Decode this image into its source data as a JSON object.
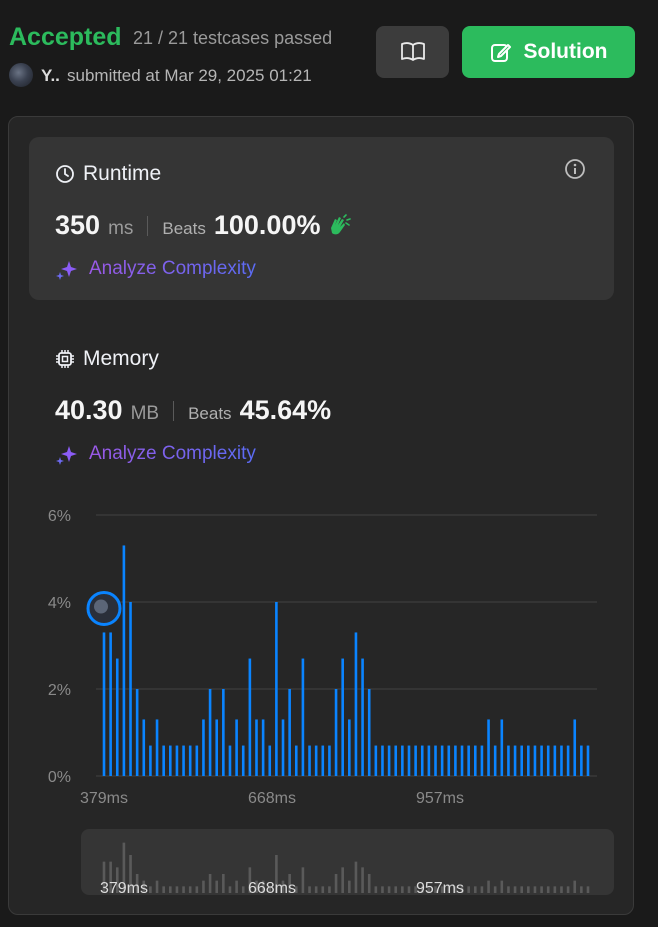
{
  "header": {
    "status": "Accepted",
    "testcases": "21 / 21 testcases passed",
    "user": "Y..",
    "submitted": "submitted at Mar 29, 2025 01:21",
    "solution_label": "Solution"
  },
  "runtime": {
    "title": "Runtime",
    "value": "350",
    "unit": "ms",
    "beats_label": "Beats",
    "beats": "100.00%",
    "analyze": "Analyze Complexity"
  },
  "memory": {
    "title": "Memory",
    "value": "40.30",
    "unit": "MB",
    "beats_label": "Beats",
    "beats": "45.64%",
    "analyze": "Analyze Complexity"
  },
  "colors": {
    "accepted": "#2cbb5d",
    "bar": "#0a84ff",
    "background": "#1a1a1a",
    "card": "#353535"
  },
  "chart_data": {
    "type": "bar",
    "xlabel": "",
    "ylabel": "",
    "yticks": [
      "6%",
      "4%",
      "2%",
      "0%"
    ],
    "xticks": [
      "379ms",
      "668ms",
      "957ms"
    ],
    "ylim": [
      0,
      6
    ],
    "grid": true,
    "values": [
      3.3,
      3.3,
      2.7,
      5.3,
      4.0,
      2.0,
      1.3,
      0.7,
      1.3,
      0.7,
      0.7,
      0.7,
      0.7,
      0.7,
      0.7,
      1.3,
      2.0,
      1.3,
      2.0,
      0.7,
      1.3,
      0.7,
      2.7,
      1.3,
      1.3,
      0.7,
      4.0,
      1.3,
      2.0,
      0.7,
      2.7,
      0.7,
      0.7,
      0.7,
      0.7,
      2.0,
      2.7,
      1.3,
      3.3,
      2.7,
      2.0,
      0.7,
      0.7,
      0.7,
      0.7,
      0.7,
      0.7,
      0.7,
      0.7,
      0.7,
      0.7,
      0.7,
      0.7,
      0.7,
      0.7,
      0.7,
      0.7,
      0.7,
      1.3,
      0.7,
      1.3,
      0.7,
      0.7,
      0.7,
      0.7,
      0.7,
      0.7,
      0.7,
      0.7,
      0.7,
      0.7,
      1.3,
      0.7,
      0.7
    ],
    "highlight_index": 0,
    "mini_xticks": [
      "379ms",
      "668ms",
      "957ms"
    ]
  }
}
